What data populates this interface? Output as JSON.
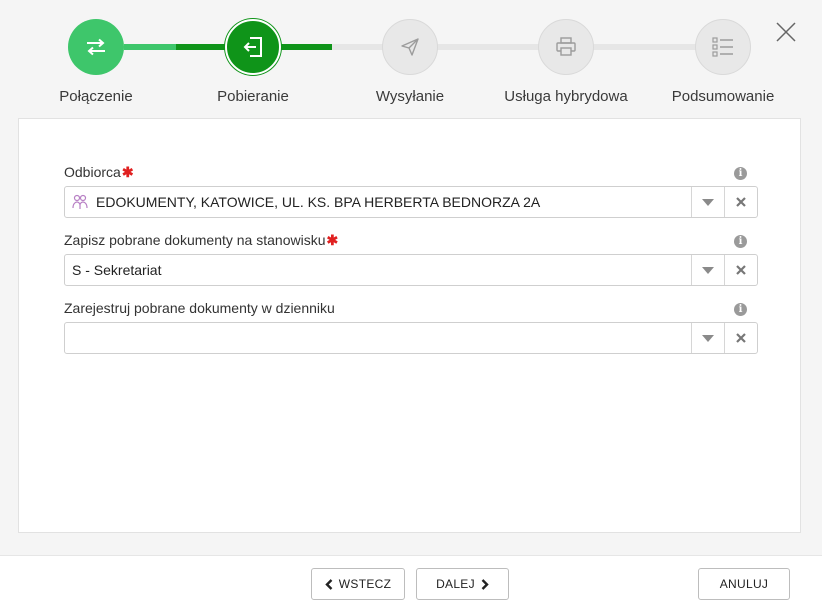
{
  "steps": [
    {
      "label": "Połączenie",
      "state": "done",
      "icon": "transfer-arrows-icon"
    },
    {
      "label": "Pobieranie",
      "state": "active",
      "icon": "sign-in-icon"
    },
    {
      "label": "Wysyłanie",
      "state": "pending",
      "icon": "send-icon"
    },
    {
      "label": "Usługa hybrydowa",
      "state": "pending",
      "icon": "printer-icon"
    },
    {
      "label": "Podsumowanie",
      "state": "pending",
      "icon": "checklist-icon"
    }
  ],
  "colors": {
    "done": "#3ec66b",
    "active": "#0f9419",
    "pending": "#e6e6e6"
  },
  "form": {
    "recipient": {
      "label": "Odbiorca",
      "required_mark": "✱",
      "value": "EDOKUMENTY, KATOWICE, UL. KS. BPA HERBERTA BEDNORZA 2A",
      "info": "i"
    },
    "workstation": {
      "label": "Zapisz pobrane dokumenty na stanowisku",
      "required_mark": "✱",
      "value": "S - Sekretariat",
      "info": "i"
    },
    "journal": {
      "label": "Zarejestruj pobrane dokumenty w dzienniku",
      "value": "",
      "info": "i"
    }
  },
  "buttons": {
    "back": "WSTECZ",
    "next": "DALEJ",
    "cancel": "ANULUJ"
  }
}
